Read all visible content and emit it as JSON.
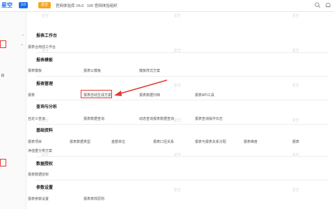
{
  "header": {
    "logo": "星空",
    "badge_version": "3.0",
    "badge_tag": "星空",
    "account": "官网体验库 V6.0",
    "org": "100 官网体验组织"
  },
  "sidebar": {
    "items": [
      {
        "label": "",
        "chevron": ""
      },
      {
        "label": "",
        "chevron": ""
      },
      {
        "label": "",
        "chevron": ""
      },
      {
        "label": "台",
        "chevron": ""
      },
      {
        "label": "",
        "chevron": ""
      },
      {
        "label": "",
        "chevron": ""
      },
      {
        "label": "",
        "chevron": ""
      },
      {
        "label": "",
        "chevron": ""
      },
      {
        "label": "",
        "chevron": ""
      },
      {
        "label": "",
        "chevron": ""
      },
      {
        "label": "",
        "chevron": ""
      },
      {
        "label": "",
        "chevron": ""
      },
      {
        "label": "",
        "chevron": ""
      },
      {
        "label": "",
        "chevron": ""
      }
    ]
  },
  "sections": [
    {
      "title": "报表工作台",
      "items": [
        "报表合用前工作台"
      ]
    },
    {
      "title": "报表模板",
      "items": [
        "报表模板",
        "报表公模板",
        "模板样式方案"
      ]
    },
    {
      "title": "报表管理",
      "items": [
        "报表",
        "报表自动生成方案",
        "报表数据归档",
        "报表API工具"
      ]
    },
    {
      "title": "查询与分析",
      "items": [
        "自定义查询",
        "报表数据查询",
        "动态查询报表数据查询",
        "报表查询操作日志"
      ]
    },
    {
      "title": "基础资料",
      "items": [
        "报表项目",
        "报表数据类型",
        "金额单位",
        "报表口径关系",
        "报表与报表关系分配",
        "报表维度",
        "报表"
      ]
    },
    {
      "title": "",
      "items": [
        "净值重分类方案"
      ]
    },
    {
      "title": "数据授权",
      "items": [
        "报表数据授权"
      ]
    },
    {
      "title": "参数设置",
      "items": [
        "报表参数设置",
        "报表表样原则"
      ]
    }
  ],
  "watermark": "星空"
}
